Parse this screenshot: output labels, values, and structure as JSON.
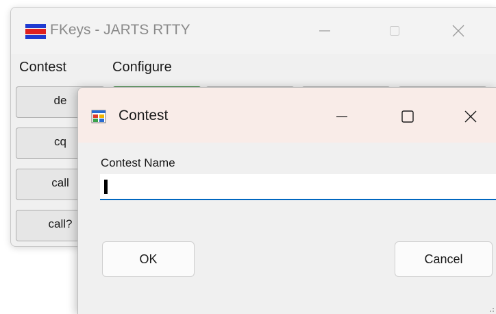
{
  "main_window": {
    "title": "FKeys - JARTS RTTY",
    "menu": [
      "Contest",
      "Configure"
    ],
    "fkeys": [
      "de",
      "cq",
      "call",
      "call?"
    ]
  },
  "dialog": {
    "title": "Contest",
    "field_label": "Contest Name",
    "field_value": "",
    "ok_label": "OK",
    "cancel_label": "Cancel"
  },
  "colors": {
    "accent": "#0067c0",
    "active_key_border": "#2e7d32",
    "dialog_titlebar": "#f9ece8"
  },
  "icons": {
    "app": "flag-stripes-icon",
    "dialog": "window-form-icon",
    "minimize": "minimize-icon",
    "maximize": "maximize-icon",
    "close": "close-icon"
  }
}
